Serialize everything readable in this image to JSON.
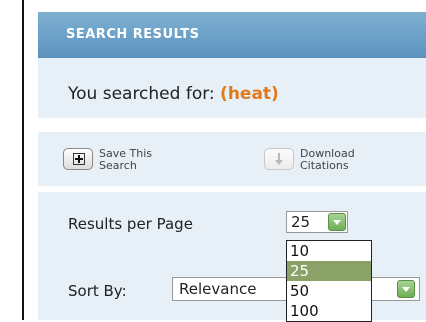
{
  "header": {
    "title": "SEARCH RESULTS"
  },
  "search": {
    "prefix": "You searched for:",
    "term": "(heat)"
  },
  "actions": {
    "save_line1": "Save This",
    "save_line2": "Search",
    "download_line1": "Download",
    "download_line2": "Citations",
    "save_icon": "plus-box-icon",
    "download_icon": "download-arrow-icon"
  },
  "results_per_page": {
    "label": "Results per Page",
    "selected": "25",
    "options": [
      "10",
      "25",
      "50",
      "100"
    ]
  },
  "sort": {
    "label": "Sort By:",
    "selected": "Relevance"
  },
  "colors": {
    "header": "#6fa2c9",
    "panel": "#e8f0f7",
    "search_term": "#e07a1c",
    "option_highlight": "#8aa167",
    "dropdown_button": "#7cba63"
  }
}
